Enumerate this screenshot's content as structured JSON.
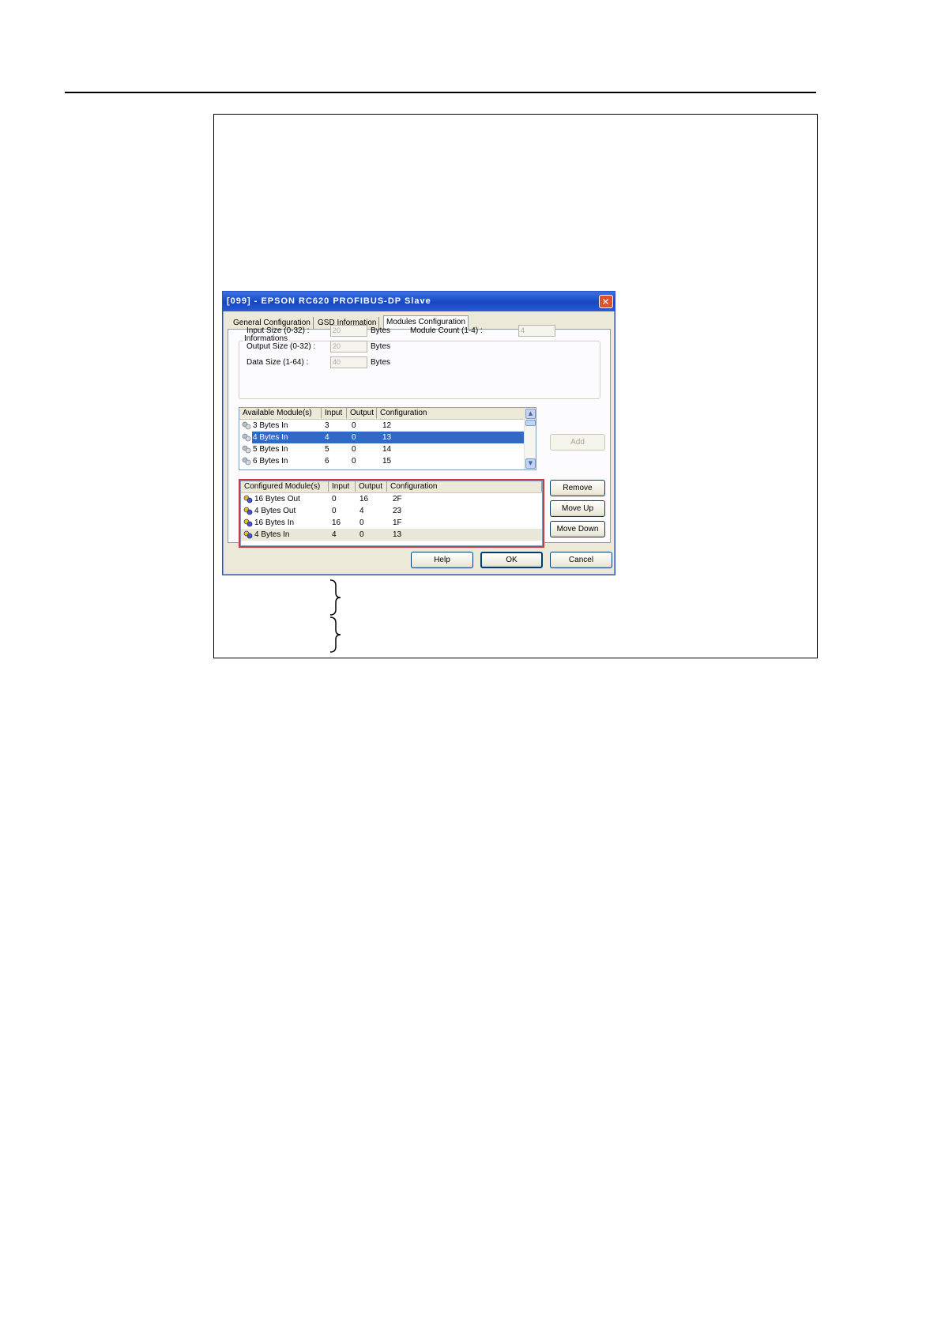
{
  "window": {
    "title": "[099] - EPSON RC620 PROFIBUS-DP Slave",
    "close_glyph": "✕"
  },
  "tabs": [
    {
      "label": "General Configuration"
    },
    {
      "label": "GSD Information"
    },
    {
      "label": "Modules Configuration",
      "active": true
    }
  ],
  "informations": {
    "legend": "Informations",
    "input_size_label": "Input Size (0-32) :",
    "input_size_value": "20",
    "output_size_label": "Output Size (0-32) :",
    "output_size_value": "20",
    "data_size_label": "Data Size (1-64) :",
    "data_size_value": "40",
    "bytes_unit": "Bytes",
    "module_count_label": "Module Count (1-4) :",
    "module_count_value": "4"
  },
  "available_modules": {
    "columns": [
      "Available Module(s)",
      "Input",
      "Output",
      "Configuration"
    ],
    "rows": [
      {
        "name": "3 Bytes In",
        "input": "3",
        "output": "0",
        "config": "12"
      },
      {
        "name": "4 Bytes In",
        "input": "4",
        "output": "0",
        "config": "13",
        "selected": true
      },
      {
        "name": "5 Bytes In",
        "input": "5",
        "output": "0",
        "config": "14"
      },
      {
        "name": "6 Bytes In",
        "input": "6",
        "output": "0",
        "config": "15"
      }
    ],
    "scroll_up_glyph": "▲",
    "scroll_down_glyph": "▼"
  },
  "configured_modules": {
    "columns": [
      "Configured Module(s)",
      "Input",
      "Output",
      "Configuration"
    ],
    "rows": [
      {
        "name": "16 Bytes Out",
        "input": "0",
        "output": "16",
        "config": "2F"
      },
      {
        "name": "4 Bytes Out",
        "input": "0",
        "output": "4",
        "config": "23"
      },
      {
        "name": "16 Bytes In",
        "input": "16",
        "output": "0",
        "config": "1F"
      },
      {
        "name": "4 Bytes In",
        "input": "4",
        "output": "0",
        "config": "13"
      }
    ]
  },
  "buttons": {
    "add": "Add",
    "remove": "Remove",
    "move_up": "Move Up",
    "move_down": "Move Down",
    "help": "Help",
    "ok": "OK",
    "cancel": "Cancel"
  },
  "icons": {
    "module_icon": "module-icon",
    "close_icon": "close-icon",
    "brace_icon": "curly-brace-icon"
  },
  "colors": {
    "titlebar": "#1b4fc9",
    "selection": "#316ac5",
    "highlight_outline": "#d03a3a",
    "close_button": "#d9542c"
  }
}
